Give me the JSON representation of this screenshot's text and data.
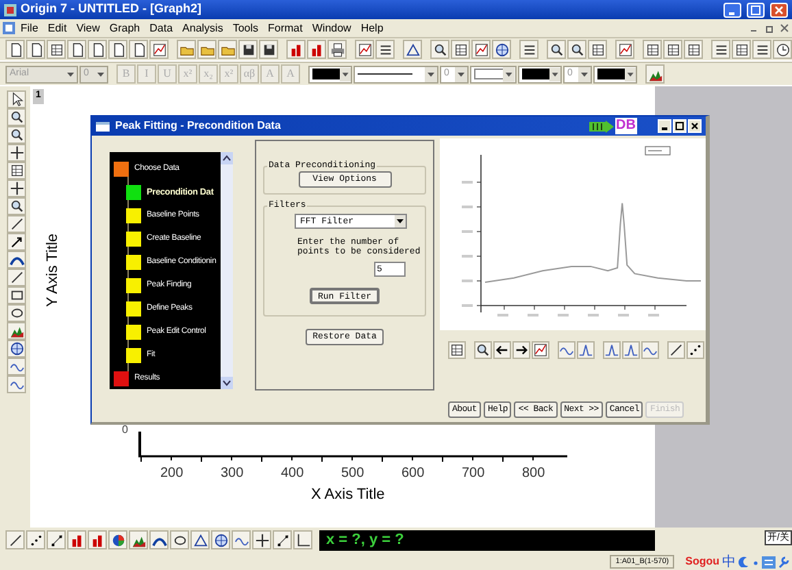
{
  "window": {
    "title": "Origin 7 - UNTITLED - [Graph2]"
  },
  "menu": [
    "File",
    "Edit",
    "View",
    "Graph",
    "Data",
    "Analysis",
    "Tools",
    "Format",
    "Window",
    "Help"
  ],
  "format_bar": {
    "font": "Arial",
    "font_size": "0",
    "style_buttons": [
      "B",
      "I",
      "U",
      "x²",
      "x₂",
      "x²",
      "αβ",
      "A",
      "A"
    ],
    "line_size": "0",
    "symbol_size": "0"
  },
  "page_tab": "1",
  "graph": {
    "y_axis_title": "Y Axis Title",
    "x_axis_title": "X Axis Title",
    "y_tick_label": "0",
    "x_tick_labels": [
      "200",
      "300",
      "400",
      "500",
      "600",
      "700",
      "800"
    ]
  },
  "dialog": {
    "title": "Peak Fitting - Precondition Data",
    "logo": "DB",
    "steps": [
      {
        "label": "Choose Data",
        "color": "#f07010",
        "selected": false
      },
      {
        "label": "Precondition Dat",
        "color": "#10e010",
        "selected": true
      },
      {
        "label": "Baseline Points",
        "color": "#f8f000",
        "selected": false
      },
      {
        "label": "Create Baseline",
        "color": "#f8f000",
        "selected": false
      },
      {
        "label": "Baseline Conditionin",
        "color": "#f8f000",
        "selected": false
      },
      {
        "label": "Peak Finding",
        "color": "#f8f000",
        "selected": false
      },
      {
        "label": "Define Peaks",
        "color": "#f8f000",
        "selected": false
      },
      {
        "label": "Peak Edit Control",
        "color": "#f8f000",
        "selected": false
      },
      {
        "label": "Fit",
        "color": "#f8f000",
        "selected": false
      },
      {
        "label": "Results",
        "color": "#e01010",
        "selected": false
      }
    ],
    "preconditioning": {
      "legend": "Data Preconditioning",
      "button": "View Options"
    },
    "filters": {
      "legend": "Filters",
      "filter": "FFT Filter",
      "prompt": "Enter the number of points to be considered",
      "points": "5",
      "button": "Run Filter"
    },
    "restore_button": "Restore Data",
    "buttons": [
      {
        "label": "About",
        "disabled": false
      },
      {
        "label": "Help",
        "disabled": false
      },
      {
        "label": "<< Back",
        "disabled": false
      },
      {
        "label": "Next >>",
        "disabled": false
      },
      {
        "label": "Cancel",
        "disabled": false
      },
      {
        "label": "Finish",
        "disabled": true
      }
    ]
  },
  "coordinates": "x = ?, y = ?",
  "ime_toggle": "开/关",
  "status": "1:A01_B(1-570)",
  "ime_bar": {
    "logo": "Sogou",
    "mode": "中"
  }
}
